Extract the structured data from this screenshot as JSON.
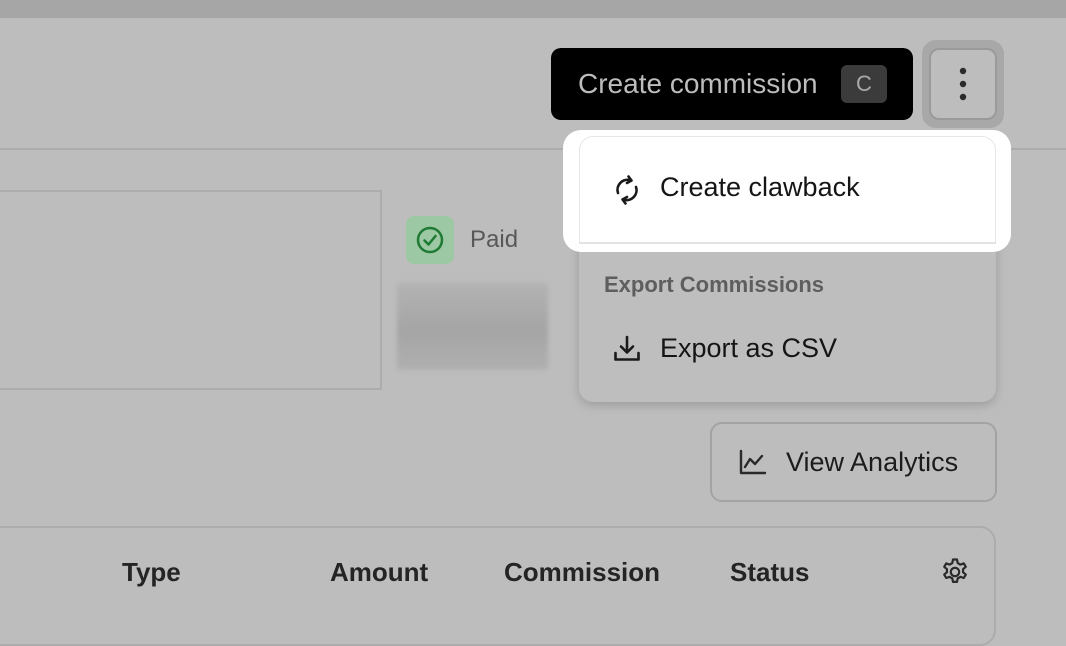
{
  "header": {
    "create_button_label": "Create commission",
    "create_shortcut": "C"
  },
  "status_card": {
    "status": "Paid"
  },
  "dropdown": {
    "items": [
      {
        "label": "Create clawback",
        "icon": "refresh-icon"
      }
    ],
    "section_label": "Export Commissions",
    "export_items": [
      {
        "label": "Export as CSV",
        "icon": "download-icon"
      }
    ]
  },
  "toolbar": {
    "view_analytics_label": "View Analytics"
  },
  "table": {
    "columns": [
      "Type",
      "Amount",
      "Commission",
      "Status"
    ]
  },
  "colors": {
    "primary_button": "#000000",
    "paid_accent": "#1f7a33",
    "menu_highlight": "#ffffff"
  }
}
